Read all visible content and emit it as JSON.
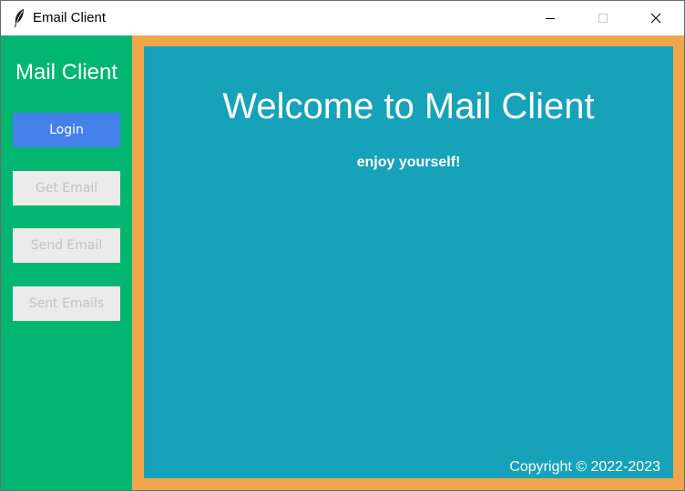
{
  "window": {
    "title": "Email Client",
    "controls": {
      "minimize": "minimize-icon",
      "maximize": "maximize-icon",
      "close": "close-icon"
    }
  },
  "sidebar": {
    "title": "Mail Client",
    "buttons": [
      {
        "label": "Login",
        "state": "enabled"
      },
      {
        "label": "Get Email",
        "state": "disabled"
      },
      {
        "label": "Send Email",
        "state": "disabled"
      },
      {
        "label": "Sent Emails",
        "state": "disabled"
      }
    ]
  },
  "main": {
    "heading": "Welcome to Mail Client",
    "subtitle": "enjoy yourself!",
    "copyright": "Copyright © 2022-2023"
  },
  "colors": {
    "sidebar_bg": "#00b670",
    "frame_border": "#f0a74b",
    "main_bg": "#16a2b9",
    "active_button": "#4581ea",
    "disabled_button": "#ebebeb",
    "disabled_text": "#c3c3c3"
  }
}
